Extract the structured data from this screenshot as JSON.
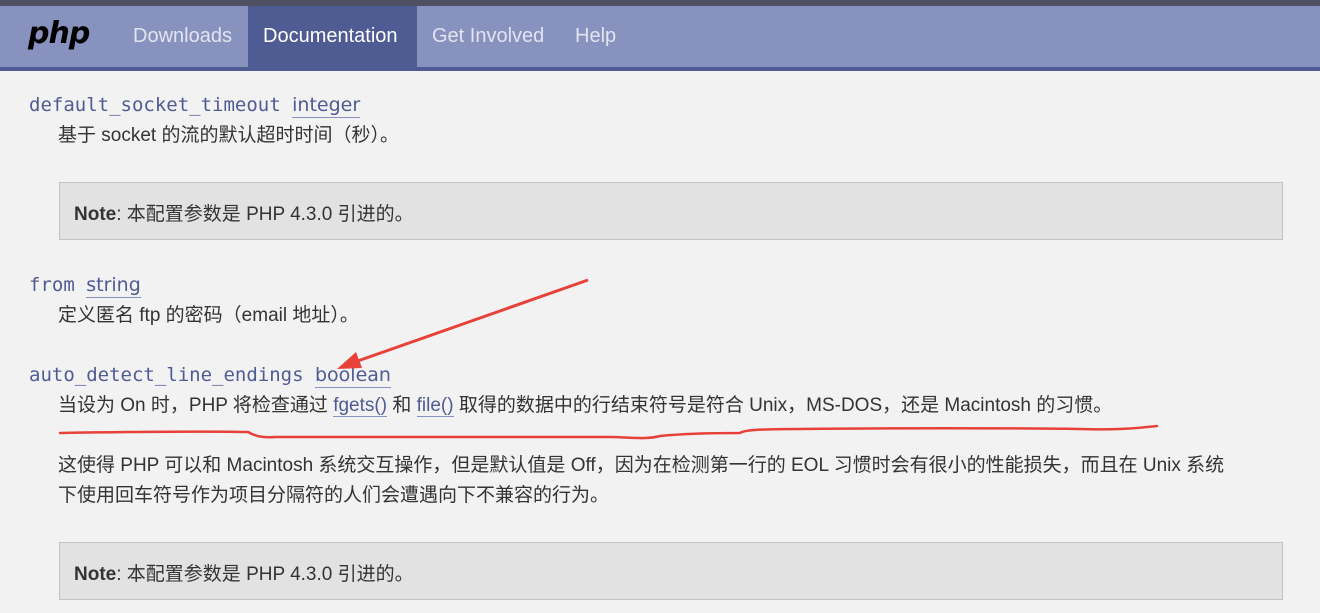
{
  "nav": {
    "logo": "php",
    "items": [
      "Downloads",
      "Documentation",
      "Get Involved",
      "Help"
    ]
  },
  "entries": [
    {
      "name": "default_socket_timeout",
      "type": "integer",
      "desc": "基于 socket 的流的默认超时时间（秒）。",
      "note_label": "Note",
      "note_text": ": 本配置参数是 PHP 4.3.0 引进的。"
    },
    {
      "name": "from",
      "type": "string",
      "desc": "定义匿名 ftp 的密码（email 地址）。"
    },
    {
      "name": "auto_detect_line_endings",
      "type": "boolean",
      "desc_part1": "当设为 On 时，PHP 将检查通过 ",
      "link1": "fgets()",
      "desc_part2": " 和 ",
      "link2": "file()",
      "desc_part3": " 取得的数据中的行结束符号是符合 Unix，MS-DOS，还是 Macintosh 的习惯。",
      "para2_line1": "这使得 PHP 可以和 Macintosh 系统交互操作，但是默认值是 Off，因为在检测第一行的 EOL 习惯时会有很小的性能损失，而且在 Unix 系统",
      "para2_line2": "下使用回车符号作为项目分隔符的人们会遭遇向下不兼容的行为。",
      "note_label": "Note",
      "note_text": ": 本配置参数是 PHP 4.3.0 引进的。"
    }
  ],
  "annotation": {
    "color": "#e8413a"
  }
}
